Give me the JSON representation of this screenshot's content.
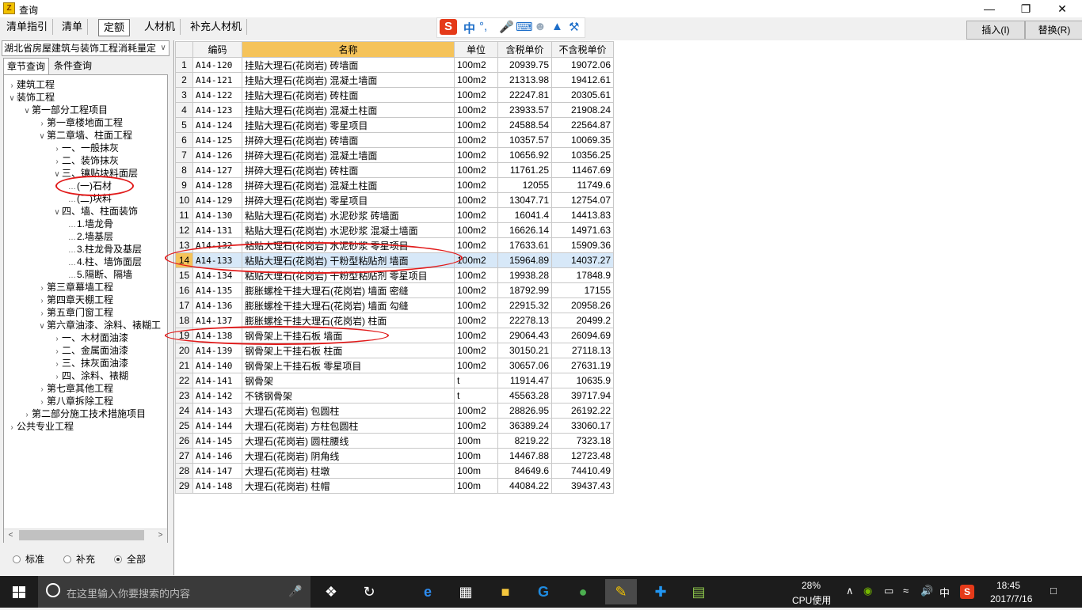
{
  "window": {
    "title": "查询"
  },
  "toolbar": {
    "tabs": [
      "清单指引",
      "清单",
      "定额",
      "人材机",
      "补充人材机"
    ],
    "active_tab": "定额",
    "insert_label": "插入(I)",
    "replace_label": "替换(R)"
  },
  "ime": {
    "mode": "中"
  },
  "left": {
    "library": "湖北省房屋建筑与装饰工程消耗量定",
    "tabs": [
      "章节查询",
      "条件查询"
    ],
    "tree": [
      {
        "label": "建筑工程",
        "level": 0,
        "toggle": "collapsed"
      },
      {
        "label": "装饰工程",
        "level": 0,
        "toggle": "expanded"
      },
      {
        "label": "第一部分工程项目",
        "level": 1,
        "toggle": "expanded"
      },
      {
        "label": "第一章楼地面工程",
        "level": 2,
        "toggle": "collapsed"
      },
      {
        "label": "第二章墙、柱面工程",
        "level": 2,
        "toggle": "expanded"
      },
      {
        "label": "一、一般抹灰",
        "level": 3,
        "toggle": "collapsed"
      },
      {
        "label": "二、装饰抹灰",
        "level": 3,
        "toggle": "collapsed"
      },
      {
        "label": "三、镶贴块料面层",
        "level": 3,
        "toggle": "expanded"
      },
      {
        "label": "(一)石材",
        "level": 4,
        "toggle": "none",
        "selected": true
      },
      {
        "label": "(二)块料",
        "level": 4,
        "toggle": "none"
      },
      {
        "label": "四、墙、柱面装饰",
        "level": 3,
        "toggle": "expanded"
      },
      {
        "label": "1.墙龙骨",
        "level": 4,
        "toggle": "none"
      },
      {
        "label": "2.墙基层",
        "level": 4,
        "toggle": "none"
      },
      {
        "label": "3.柱龙骨及基层",
        "level": 4,
        "toggle": "none"
      },
      {
        "label": "4.柱、墙饰面层",
        "level": 4,
        "toggle": "none"
      },
      {
        "label": "5.隔断、隔墙",
        "level": 4,
        "toggle": "none"
      },
      {
        "label": "第三章幕墙工程",
        "level": 2,
        "toggle": "collapsed"
      },
      {
        "label": "第四章天棚工程",
        "level": 2,
        "toggle": "collapsed"
      },
      {
        "label": "第五章门窗工程",
        "level": 2,
        "toggle": "collapsed"
      },
      {
        "label": "第六章油漆、涂料、裱糊工",
        "level": 2,
        "toggle": "expanded"
      },
      {
        "label": "一、木材面油漆",
        "level": 3,
        "toggle": "collapsed"
      },
      {
        "label": "二、金属面油漆",
        "level": 3,
        "toggle": "collapsed"
      },
      {
        "label": "三、抹灰面油漆",
        "level": 3,
        "toggle": "collapsed"
      },
      {
        "label": "四、涂料、裱糊",
        "level": 3,
        "toggle": "collapsed"
      },
      {
        "label": "第七章其他工程",
        "level": 2,
        "toggle": "collapsed"
      },
      {
        "label": "第八章拆除工程",
        "level": 2,
        "toggle": "collapsed"
      },
      {
        "label": "第二部分施工技术措施项目",
        "level": 1,
        "toggle": "collapsed"
      },
      {
        "label": "公共专业工程",
        "level": 0,
        "toggle": "collapsed"
      }
    ],
    "filters": [
      {
        "label": "标准",
        "checked": false
      },
      {
        "label": "补充",
        "checked": false
      },
      {
        "label": "全部",
        "checked": true
      }
    ]
  },
  "grid": {
    "columns": [
      "编码",
      "名称",
      "单位",
      "含税单价",
      "不含税单价"
    ],
    "selected_row": 14,
    "rows": [
      [
        "1",
        "A14-120",
        "挂贴大理石(花岗岩) 砖墙面",
        "100m2",
        "20939.75",
        "19072.06"
      ],
      [
        "2",
        "A14-121",
        "挂贴大理石(花岗岩) 混凝土墙面",
        "100m2",
        "21313.98",
        "19412.61"
      ],
      [
        "3",
        "A14-122",
        "挂贴大理石(花岗岩) 砖柱面",
        "100m2",
        "22247.81",
        "20305.61"
      ],
      [
        "4",
        "A14-123",
        "挂贴大理石(花岗岩) 混凝土柱面",
        "100m2",
        "23933.57",
        "21908.24"
      ],
      [
        "5",
        "A14-124",
        "挂贴大理石(花岗岩) 零星项目",
        "100m2",
        "24588.54",
        "22564.87"
      ],
      [
        "6",
        "A14-125",
        "拼碎大理石(花岗岩) 砖墙面",
        "100m2",
        "10357.57",
        "10069.35"
      ],
      [
        "7",
        "A14-126",
        "拼碎大理石(花岗岩) 混凝土墙面",
        "100m2",
        "10656.92",
        "10356.25"
      ],
      [
        "8",
        "A14-127",
        "拼碎大理石(花岗岩) 砖柱面",
        "100m2",
        "11761.25",
        "11467.69"
      ],
      [
        "9",
        "A14-128",
        "拼碎大理石(花岗岩) 混凝土柱面",
        "100m2",
        "12055",
        "11749.6"
      ],
      [
        "10",
        "A14-129",
        "拼碎大理石(花岗岩) 零星项目",
        "100m2",
        "13047.71",
        "12754.07"
      ],
      [
        "11",
        "A14-130",
        "粘贴大理石(花岗岩) 水泥砂浆 砖墙面",
        "100m2",
        "16041.4",
        "14413.83"
      ],
      [
        "12",
        "A14-131",
        "粘贴大理石(花岗岩) 水泥砂浆 混凝土墙面",
        "100m2",
        "16626.14",
        "14971.63"
      ],
      [
        "13",
        "A14-132",
        "粘贴大理石(花岗岩) 水泥砂浆 零星项目",
        "100m2",
        "17633.61",
        "15909.36"
      ],
      [
        "14",
        "A14-133",
        "粘贴大理石(花岗岩) 干粉型粘贴剂 墙面",
        "100m2",
        "15964.89",
        "14037.27"
      ],
      [
        "15",
        "A14-134",
        "粘贴大理石(花岗岩) 干粉型粘贴剂 零星项目",
        "100m2",
        "19938.28",
        "17848.9"
      ],
      [
        "16",
        "A14-135",
        "膨胀螺栓干挂大理石(花岗岩) 墙面 密缝",
        "100m2",
        "18792.99",
        "17155"
      ],
      [
        "17",
        "A14-136",
        "膨胀螺栓干挂大理石(花岗岩) 墙面 勾缝",
        "100m2",
        "22915.32",
        "20958.26"
      ],
      [
        "18",
        "A14-137",
        "膨胀螺栓干挂大理石(花岗岩) 柱面",
        "100m2",
        "22278.13",
        "20499.2"
      ],
      [
        "19",
        "A14-138",
        "钢骨架上干挂石板 墙面",
        "100m2",
        "29064.43",
        "26094.69"
      ],
      [
        "20",
        "A14-139",
        "钢骨架上干挂石板 柱面",
        "100m2",
        "30150.21",
        "27118.13"
      ],
      [
        "21",
        "A14-140",
        "钢骨架上干挂石板 零星项目",
        "100m2",
        "30657.06",
        "27631.19"
      ],
      [
        "22",
        "A14-141",
        "钢骨架",
        "t",
        "11914.47",
        "10635.9"
      ],
      [
        "23",
        "A14-142",
        "不锈钢骨架",
        "t",
        "45563.28",
        "39717.94"
      ],
      [
        "24",
        "A14-143",
        "大理石(花岗岩) 包圆柱",
        "100m2",
        "28826.95",
        "26192.22"
      ],
      [
        "25",
        "A14-144",
        "大理石(花岗岩) 方柱包圆柱",
        "100m2",
        "36389.24",
        "33060.17"
      ],
      [
        "26",
        "A14-145",
        "大理石(花岗岩) 圆柱腰线",
        "100m",
        "8219.22",
        "7323.18"
      ],
      [
        "27",
        "A14-146",
        "大理石(花岗岩) 阴角线",
        "100m",
        "14467.88",
        "12723.48"
      ],
      [
        "28",
        "A14-147",
        "大理石(花岗岩) 柱墩",
        "100m",
        "84649.6",
        "74410.49"
      ],
      [
        "29",
        "A14-148",
        "大理石(花岗岩) 柱帽",
        "100m",
        "44084.22",
        "39437.43"
      ]
    ]
  },
  "taskbar": {
    "search_placeholder": "在这里输入你要搜索的内容",
    "cpu_percent": "28%",
    "cpu_label": "CPU使用",
    "ime": "中",
    "time": "18:45",
    "date": "2017/7/16"
  }
}
